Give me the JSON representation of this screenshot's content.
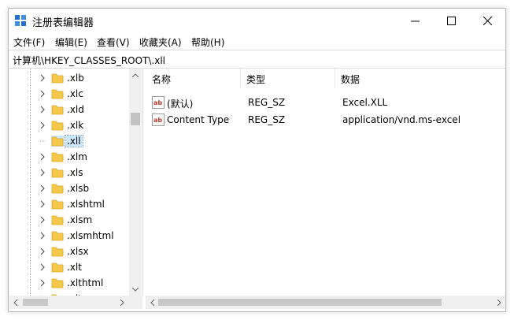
{
  "window": {
    "title": "注册表编辑器"
  },
  "menu": [
    "文件(F)",
    "编辑(E)",
    "查看(V)",
    "收藏夹(A)",
    "帮助(H)"
  ],
  "address": "计算机\\HKEY_CLASSES_ROOT\\.xll",
  "tree": [
    {
      "label": ".xlb",
      "expandable": true
    },
    {
      "label": ".xlc",
      "expandable": true
    },
    {
      "label": ".xld",
      "expandable": true
    },
    {
      "label": ".xlk",
      "expandable": true
    },
    {
      "label": ".xll",
      "expandable": false,
      "selected": true
    },
    {
      "label": ".xlm",
      "expandable": true
    },
    {
      "label": ".xls",
      "expandable": true
    },
    {
      "label": ".xlsb",
      "expandable": true
    },
    {
      "label": ".xlshtml",
      "expandable": true
    },
    {
      "label": ".xlsm",
      "expandable": true
    },
    {
      "label": ".xlsmhtml",
      "expandable": true
    },
    {
      "label": ".xlsx",
      "expandable": true
    },
    {
      "label": ".xlt",
      "expandable": true
    },
    {
      "label": ".xlthtml",
      "expandable": true
    },
    {
      "label": ".xltm",
      "expandable": true
    }
  ],
  "columns": [
    "名称",
    "类型",
    "数据"
  ],
  "values": [
    {
      "name": "(默认)",
      "type": "REG_SZ",
      "data": "Excel.XLL"
    },
    {
      "name": "Content Type",
      "type": "REG_SZ",
      "data": "application/vnd.ms-excel"
    }
  ],
  "icons": {
    "app": "registry-editor-icon",
    "folder": "folder-icon",
    "value": "string-value-icon"
  },
  "colors": {
    "folder": "#f5c84c",
    "selection": "#cce8ff",
    "value_icon_red": "#c0392b"
  }
}
